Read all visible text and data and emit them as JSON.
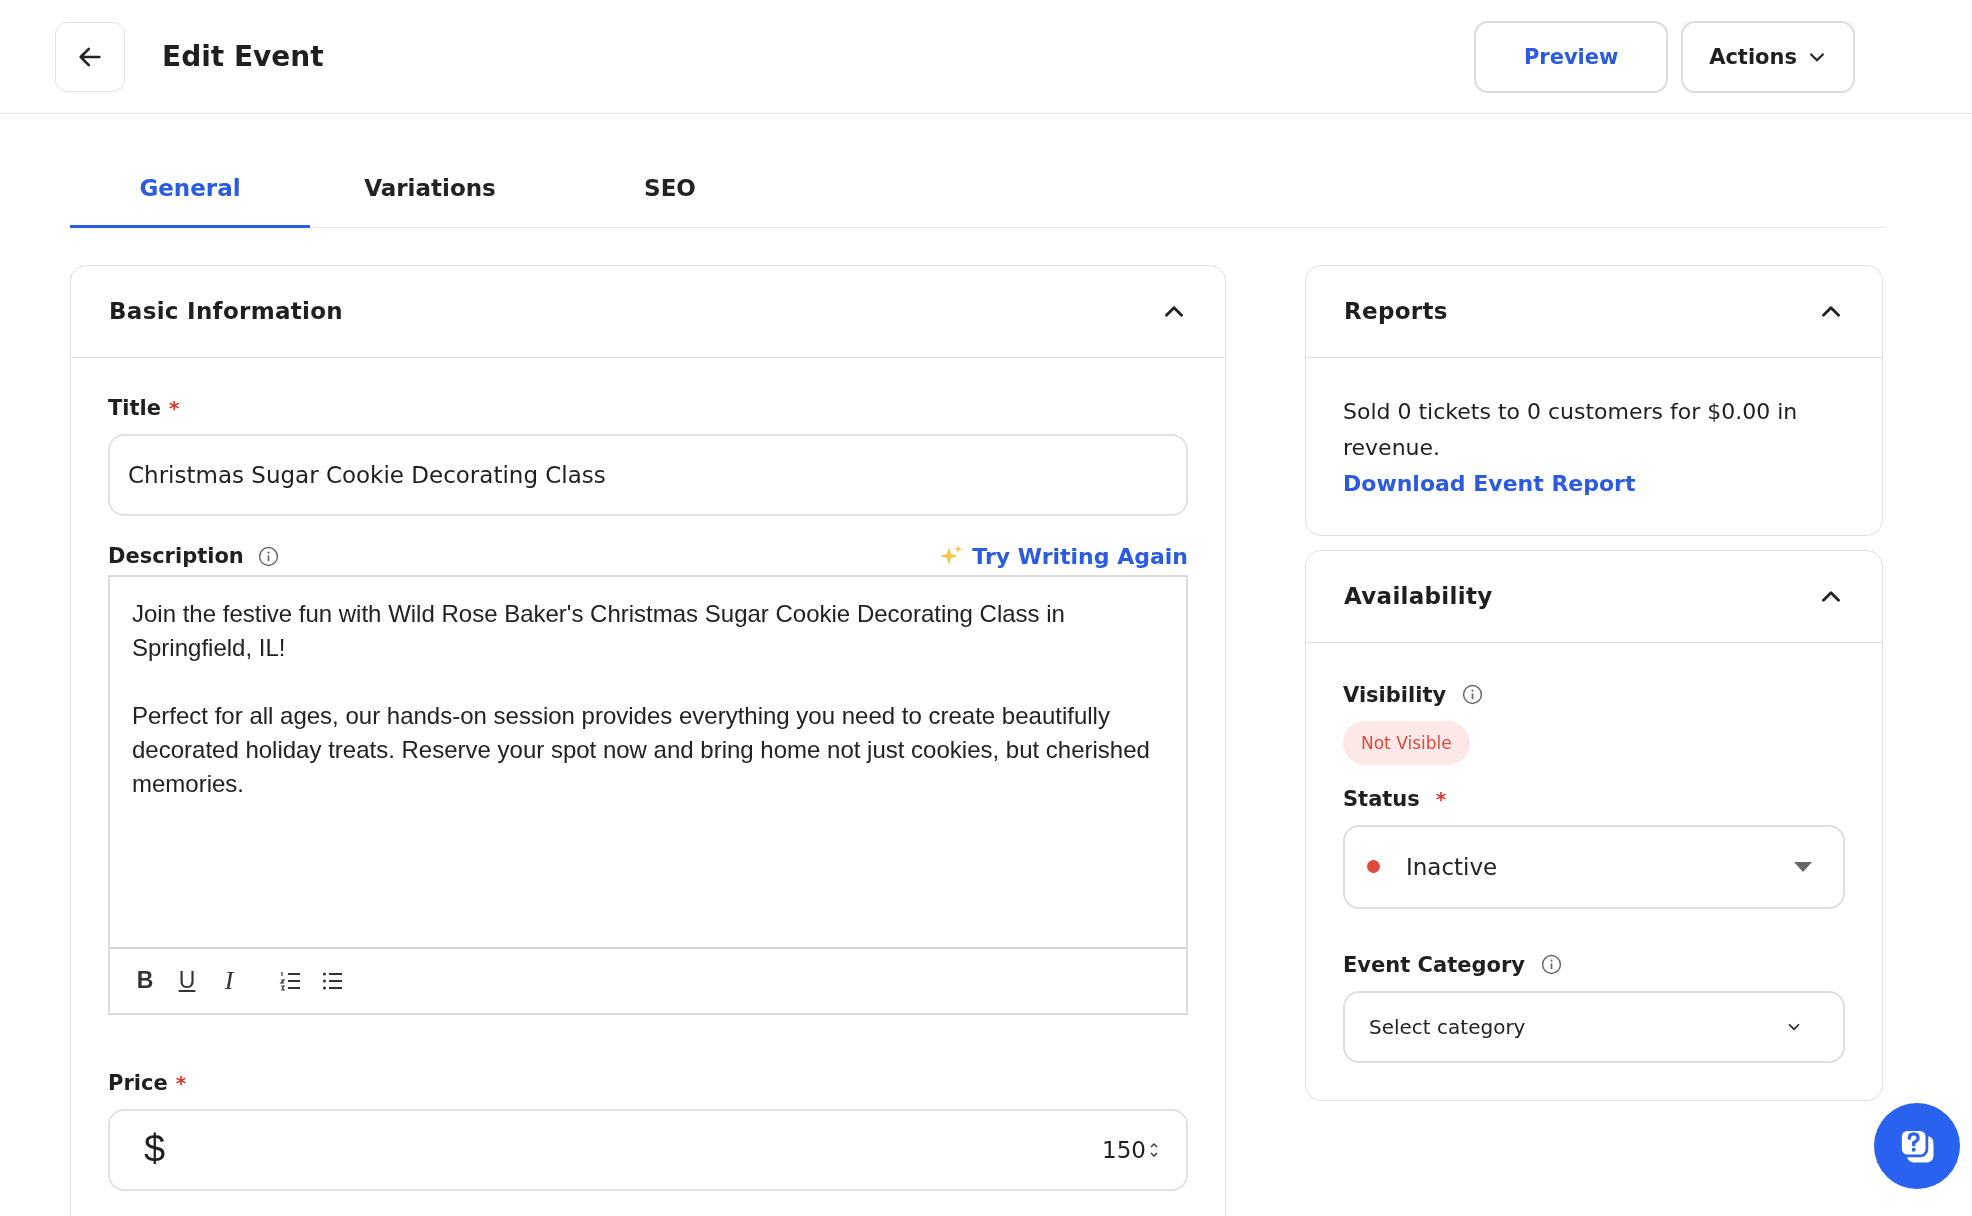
{
  "header": {
    "title": "Edit Event",
    "buttons": [
      {
        "label": "Preview",
        "kind": "link"
      },
      {
        "label": "Actions",
        "kind": "menu"
      }
    ]
  },
  "tabs": [
    {
      "label": "General",
      "selected": true
    },
    {
      "label": "Variations",
      "selected": false
    },
    {
      "label": "SEO",
      "selected": false
    }
  ],
  "basic_information": {
    "title": "Basic Information",
    "expanded": true,
    "title_field": {
      "label": "Title",
      "required_mark": "*",
      "value": "Christmas Sugar Cookie Decorating Class"
    },
    "description": {
      "label": "Description",
      "action": "Try Writing Again",
      "paragraphs": [
        "Join the festive fun with Wild Rose Baker's Christmas Sugar Cookie Decorating Class in Springfield, IL!",
        "Perfect for all ages, our hands-on session provides everything you need to create beautifully decorated holiday treats. Reserve your spot now and bring home not just cookies, but cherished memories."
      ],
      "toolbar": [
        {
          "kind": "bold",
          "label": "B"
        },
        {
          "kind": "underline",
          "label": "U"
        },
        {
          "kind": "italic",
          "label": "I"
        },
        {
          "kind": "ordered_list"
        },
        {
          "kind": "bullet_list"
        }
      ]
    },
    "price": {
      "label": "Price",
      "required_mark": "*",
      "currency": "$",
      "value": "150"
    }
  },
  "reports": {
    "title": "Reports",
    "expanded": true,
    "summary": "Sold 0 tickets to 0 customers for $0.00 in revenue.",
    "link": "Download Event Report"
  },
  "availability": {
    "title": "Availability",
    "expanded": true,
    "visibility": {
      "label": "Visibility",
      "badge": "Not Visible"
    },
    "status": {
      "label": "Status",
      "required_mark": "*",
      "value": "Inactive",
      "color": "#e0493c"
    },
    "event_category": {
      "label": "Event Category",
      "placeholder": "Select category"
    }
  }
}
